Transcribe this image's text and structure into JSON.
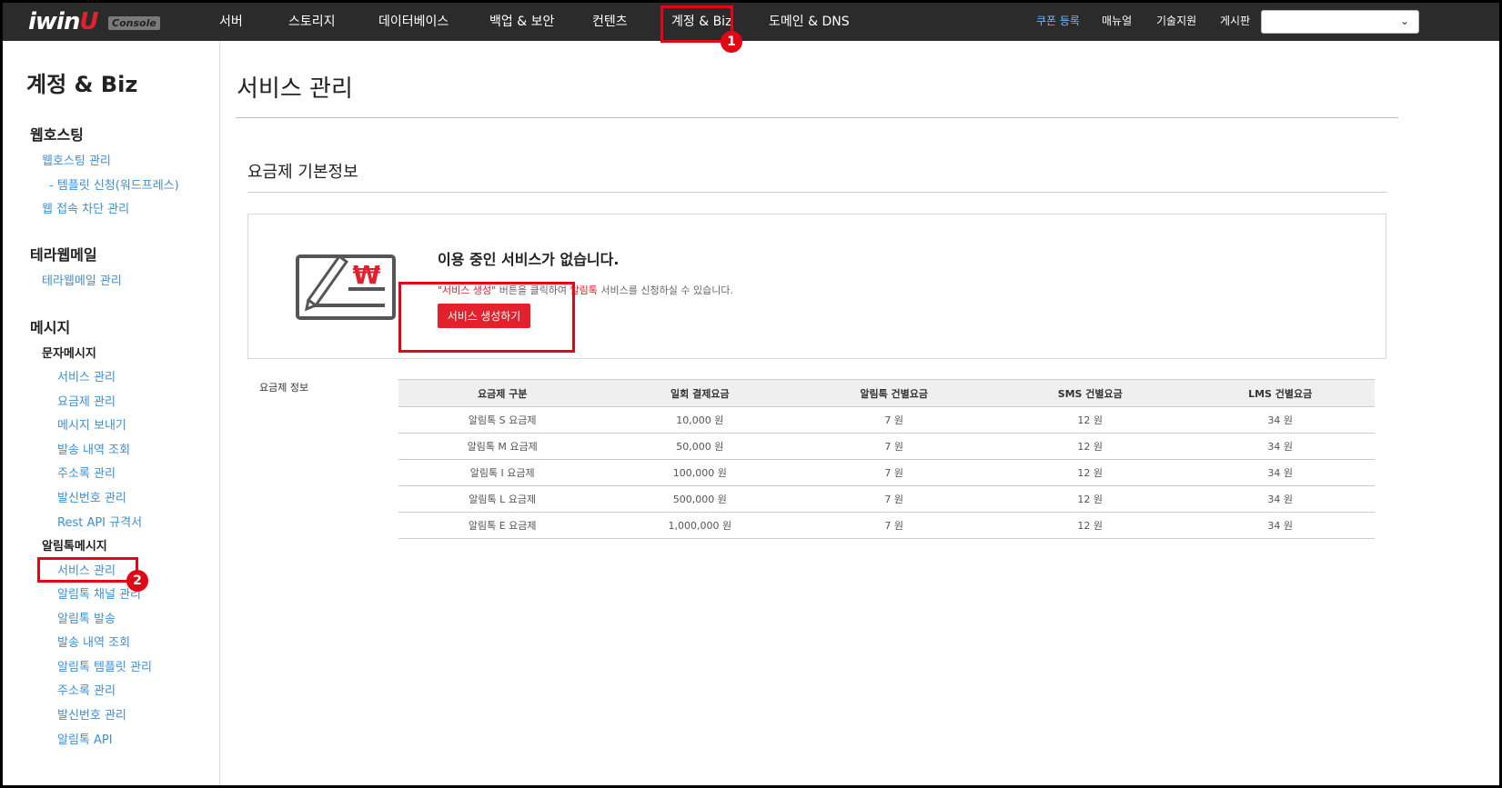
{
  "header": {
    "logo_text": "iwin",
    "logo_mark": "U",
    "console_label": "Console",
    "nav": [
      "서버",
      "스토리지",
      "데이터베이스",
      "백업 & 보안",
      "컨텐츠",
      "계정 & Biz",
      "도메인 & DNS"
    ],
    "utils": [
      "쿠폰 등록",
      "매뉴얼",
      "기술지원",
      "게시판"
    ],
    "select_value": ""
  },
  "annotations": {
    "badge1": "1",
    "badge2": "2"
  },
  "sidebar": {
    "title": "계정 & Biz",
    "webhosting": {
      "heading": "웹호스팅",
      "links": [
        "웹호스팅 관리",
        "- 템플릿 신청(워드프레스)",
        "웹 접속 차단 관리"
      ]
    },
    "terramail": {
      "heading": "테라웹메일",
      "links": [
        "테라웹메일 관리"
      ]
    },
    "message": {
      "heading": "메시지",
      "sms_heading": "문자메시지",
      "sms_links": [
        "서비스 관리",
        "요금제 관리",
        "메시지 보내기",
        "발송 내역 조회",
        "주소록 관리",
        "발신번호 관리",
        "Rest API 규격서"
      ],
      "alim_heading": "알림톡메시지",
      "alim_links": [
        "서비스 관리",
        "알림톡 채널 관리",
        "알림톡 발송",
        "발송 내역 조회",
        "알림톡 템플릿 관리",
        "주소록 관리",
        "발신번호 관리",
        "알림톡 API"
      ]
    }
  },
  "main": {
    "page_title": "서비스 관리",
    "section_title": "요금제 기본정보",
    "empty": {
      "heading": "이용 중인 서비스가 없습니다.",
      "desc_part1": "\"서비스 생성\"",
      "desc_part2": " 버튼을 클릭하여 ",
      "desc_part3": "알림톡",
      "desc_part4": " 서비스를 신청하실 수 있습니다.",
      "button": "서비스 생성하기"
    },
    "table_label": "요금제 정보",
    "table": {
      "headers": [
        "요금제 구분",
        "일회 결제요금",
        "알림톡 건별요금",
        "SMS 건별요금",
        "LMS 건별요금"
      ],
      "rows": [
        [
          "알림톡 S 요금제",
          "10,000 원",
          "7 원",
          "12 원",
          "34 원"
        ],
        [
          "알림톡 M 요금제",
          "50,000 원",
          "7 원",
          "12 원",
          "34 원"
        ],
        [
          "알림톡 I 요금제",
          "100,000 원",
          "7 원",
          "12 원",
          "34 원"
        ],
        [
          "알림톡 L 요금제",
          "500,000 원",
          "7 원",
          "12 원",
          "34 원"
        ],
        [
          "알림톡 E 요금제",
          "1,000,000 원",
          "7 원",
          "12 원",
          "34 원"
        ]
      ]
    }
  },
  "colors": {
    "accent": "#e4202c",
    "nav_bg": "#2b2b2b",
    "link": "#3d8fd6",
    "annotation": "#e30613"
  },
  "icons": {
    "service_card": "won-card-icon",
    "select_chevron": "chevron-down-icon"
  }
}
